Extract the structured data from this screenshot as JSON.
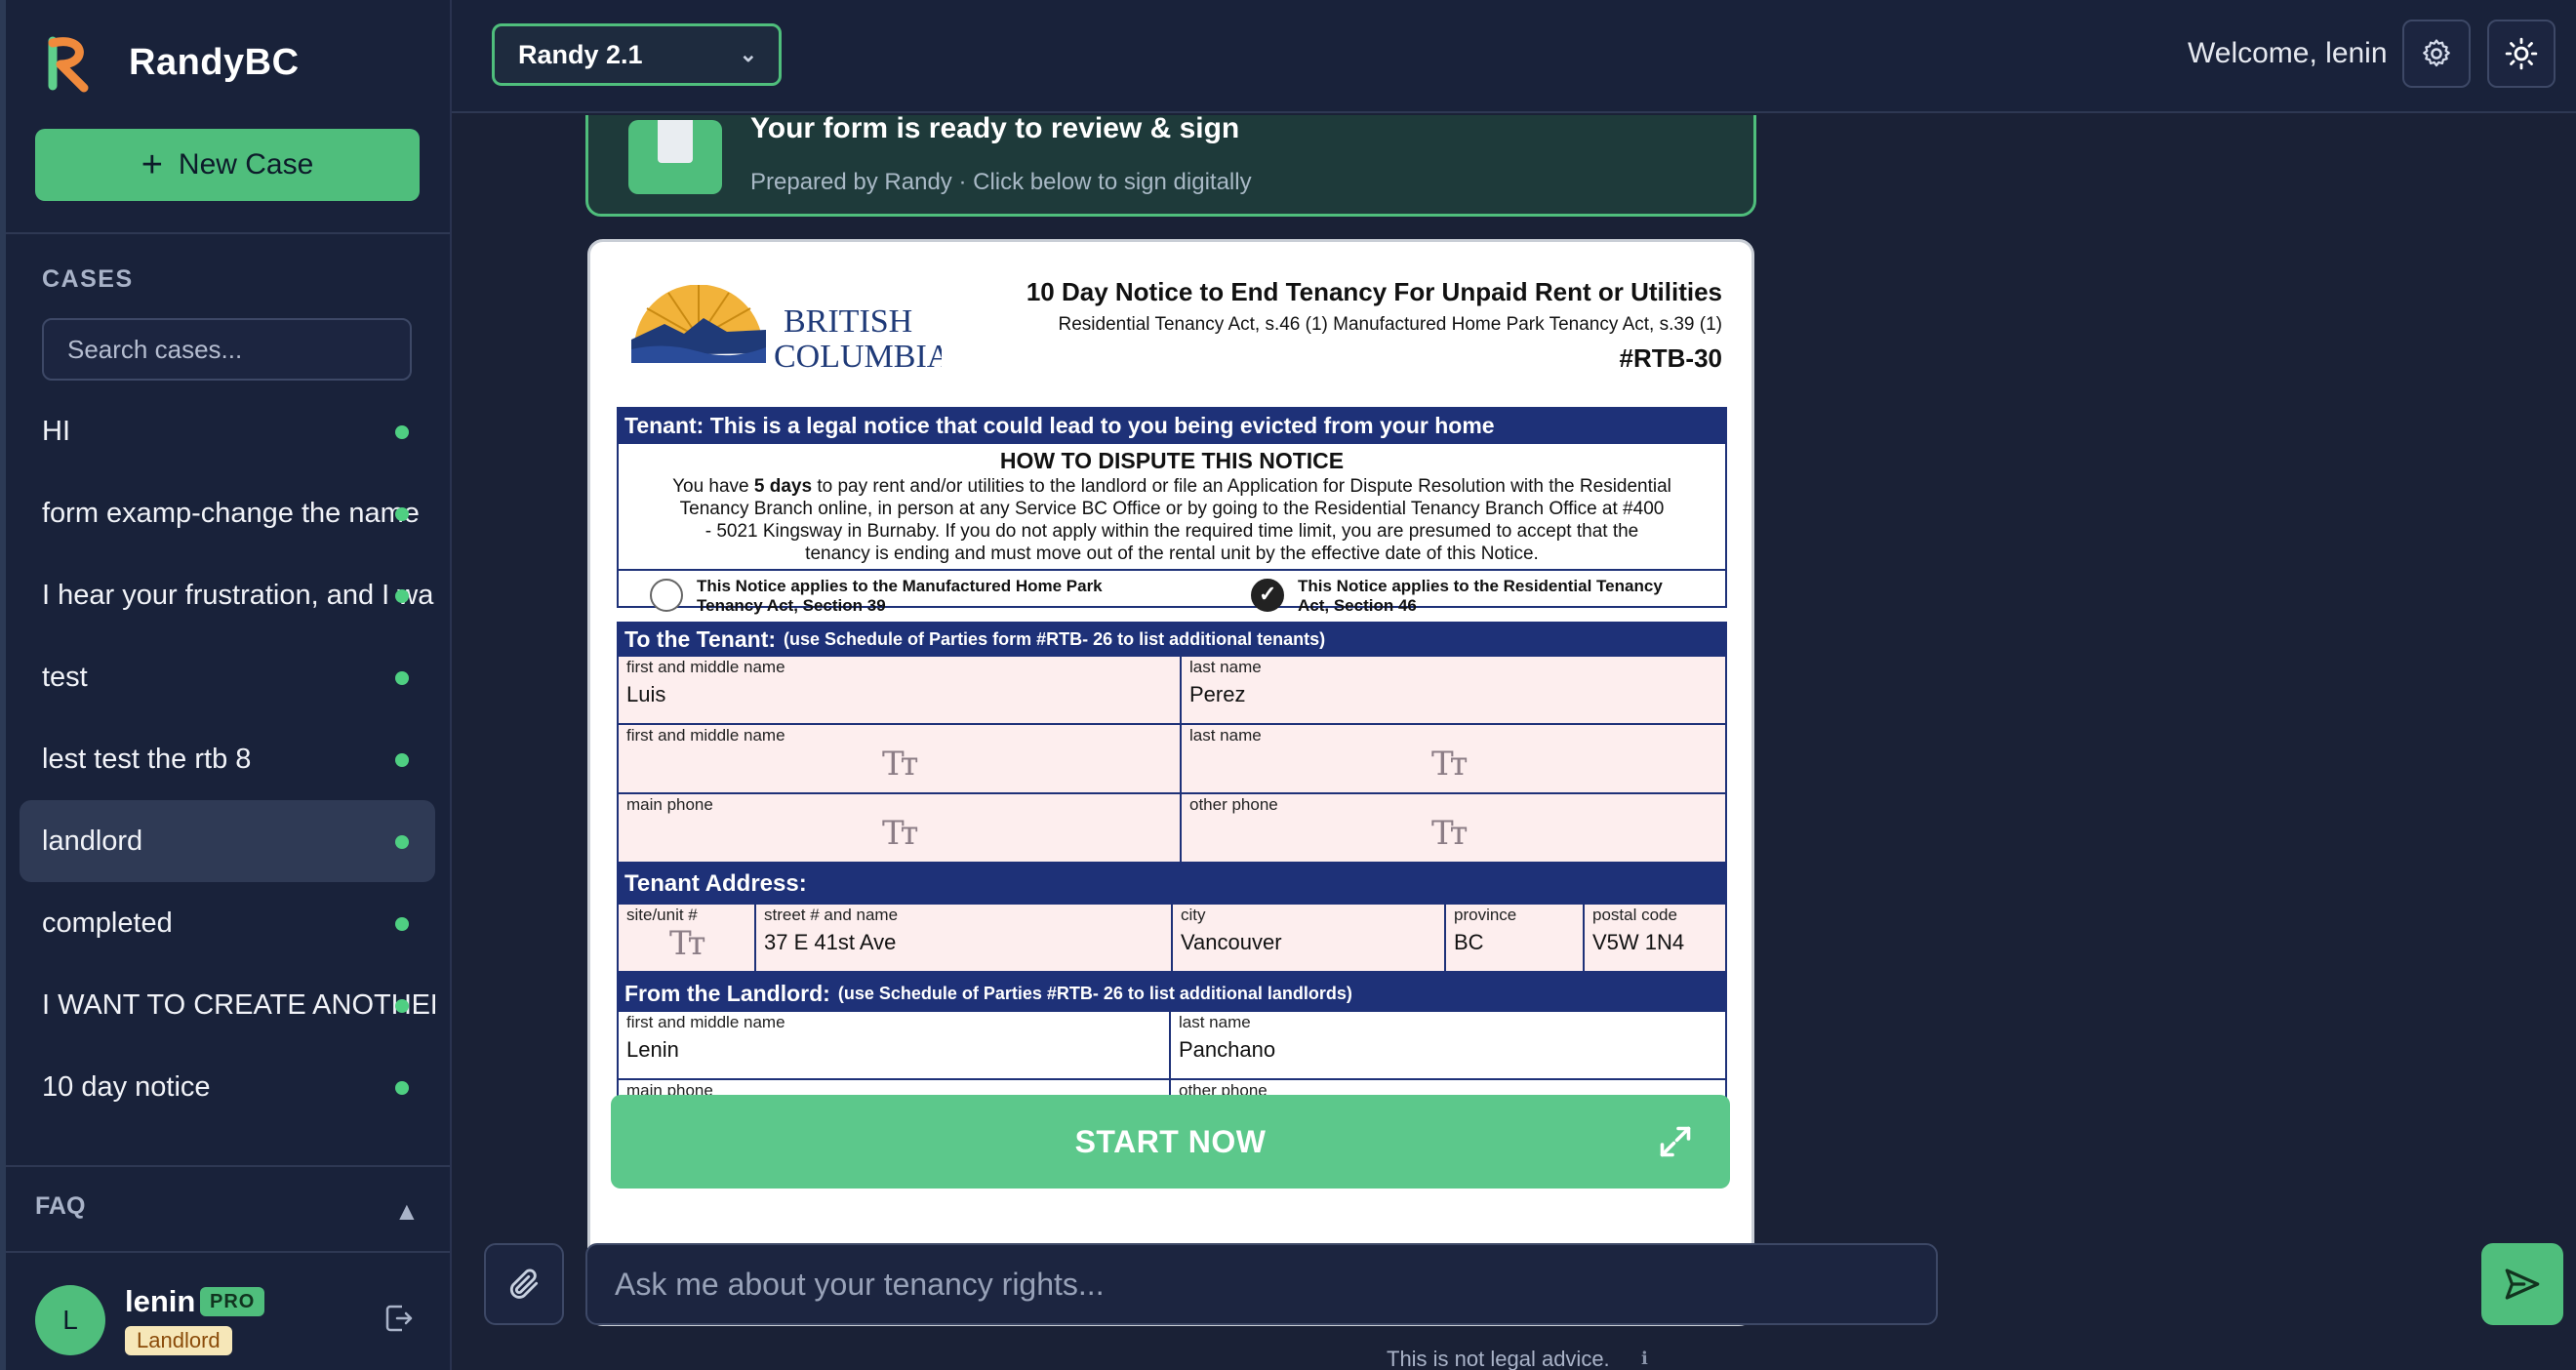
{
  "app": {
    "name": "RandyBC"
  },
  "sidebar": {
    "new_case_label": "New Case",
    "cases_heading": "CASES",
    "search_placeholder": "Search cases...",
    "cases": [
      {
        "label": "HI"
      },
      {
        "label": "form examp-change the name"
      },
      {
        "label": "I hear your frustration, and I wa"
      },
      {
        "label": "test"
      },
      {
        "label": "lest test the rtb 8"
      },
      {
        "label": "landlord",
        "active": true
      },
      {
        "label": "completed"
      },
      {
        "label": "I WANT TO CREATE ANOTHER"
      },
      {
        "label": "10 day notice"
      }
    ],
    "faq_label": "FAQ",
    "user": {
      "initial": "L",
      "name": "lenin",
      "plan_badge": "PRO",
      "role_badge": "Landlord"
    }
  },
  "topbar": {
    "model_selected": "Randy 2.1",
    "welcome": "Welcome, lenin"
  },
  "ready_card": {
    "title": "Your form is ready to review & sign",
    "subtitle": "Prepared by Randy · Click below to sign digitally"
  },
  "form": {
    "logo_line1": "BRITISH",
    "logo_line2": "COLUMBIA",
    "title": "10 Day Notice to End Tenancy For Unpaid Rent or Utilities",
    "act_line": "Residential Tenancy Act, s.46 (1) Manufactured Home Park Tenancy Act, s.39 (1)",
    "code": "#RTB-30",
    "warning_band": "Tenant: This is a legal notice that could lead to you being evicted from your home",
    "dispute_heading": "HOW TO DISPUTE THIS NOTICE",
    "dispute_line1_pre": "You have ",
    "dispute_days": "5 days",
    "dispute_line1_post": " to pay rent and/or utilities to the landlord or file an Application for Dispute Resolution with the Residential",
    "dispute_line2": "Tenancy Branch online, in person at any Service BC Office or by going to the Residential Tenancy Branch Office at #400",
    "dispute_line3": "- 5021 Kingsway in Burnaby.  If you do not apply within the required time limit, you are presumed to accept that the",
    "dispute_line4": "tenancy is ending and must move out of the rental unit by the effective date of this Notice.",
    "option_mhp_line1": "This Notice applies to the Manufactured Home Park",
    "option_mhp_line2": "Tenancy Act, Section 39",
    "option_rta_line1": "This Notice applies to the Residential Tenancy",
    "option_rta_line2": "Act, Section 46",
    "to_tenant_band": "To the Tenant:",
    "to_tenant_note": "(use Schedule of Parties form #RTB- 26 to list additional tenants)",
    "lbl_first_middle": "first and middle name",
    "lbl_last": "last name",
    "lbl_main_phone": "main phone",
    "lbl_other_phone": "other phone",
    "tenant1_first": "Luis",
    "tenant1_last": "Perez",
    "tenant_address_band": "Tenant Address:",
    "lbl_site": "site/unit #",
    "lbl_street": "street # and name",
    "lbl_city": "city",
    "lbl_province": "province",
    "lbl_postal": "postal code",
    "tenant_street": "37 E 41st Ave",
    "tenant_city": "Vancouver",
    "tenant_province": "BC",
    "tenant_postal": "V5W 1N4",
    "from_landlord_band": "From the Landlord:",
    "from_landlord_note": "(use Schedule of Parties #RTB- 26 to list additional landlords)",
    "landlord_first": "Lenin",
    "landlord_last": "Panchano",
    "text_field_glyph": "Tт"
  },
  "start_now_label": "START NOW",
  "chat": {
    "placeholder": "Ask me about your tenancy rights...",
    "disclaimer": "This is not legal advice.",
    "info_glyph": "ℹ"
  },
  "colors": {
    "accent": "#4fbe7c",
    "background": "#1a2136",
    "form_band": "#1e3178",
    "field_fill": "#fdeeee"
  }
}
